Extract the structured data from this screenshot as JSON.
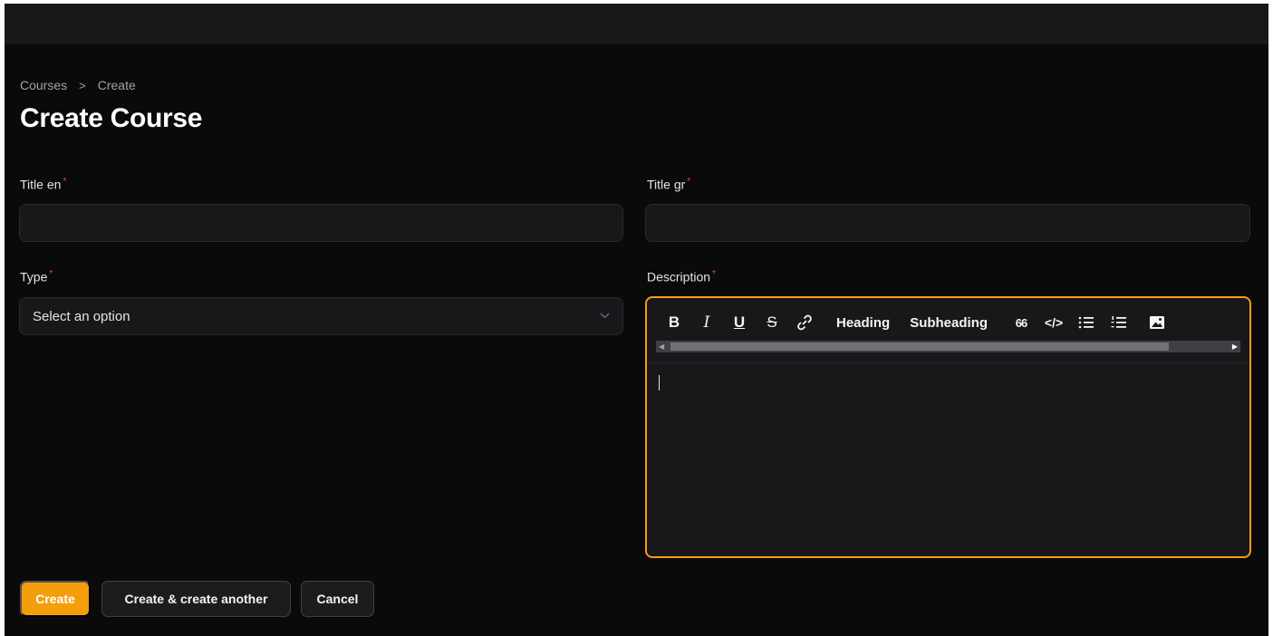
{
  "breadcrumb": {
    "parent": "Courses",
    "separator": ">",
    "current": "Create"
  },
  "page": {
    "title": "Create Course"
  },
  "form": {
    "title_en": {
      "label": "Title en",
      "required": "*",
      "value": ""
    },
    "title_gr": {
      "label": "Title gr",
      "required": "*",
      "value": ""
    },
    "type": {
      "label": "Type",
      "required": "*",
      "placeholder": "Select an option"
    },
    "description": {
      "label": "Description",
      "required": "*",
      "toolbar": {
        "bold": "B",
        "italic": "I",
        "underline": "U",
        "strike": "S",
        "heading": "Heading",
        "subheading": "Subheading",
        "quote": "66",
        "code": "</>"
      }
    }
  },
  "actions": {
    "create": "Create",
    "create_another": "Create & create another",
    "cancel": "Cancel"
  },
  "colors": {
    "accent": "#f59e0b",
    "required": "#ef4444",
    "background": "#0a0a0b",
    "topbar": "#18181b"
  }
}
